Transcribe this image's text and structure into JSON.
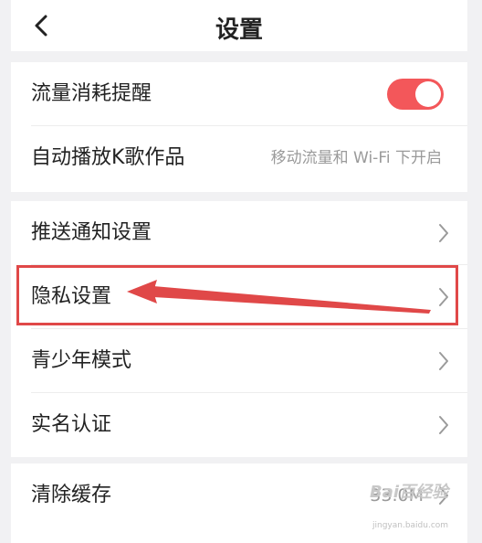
{
  "header": {
    "title": "设置",
    "back_icon": "chevron-left-icon"
  },
  "section1": {
    "rows": [
      {
        "label": "流量消耗提醒",
        "toggle_on": true,
        "toggle_color": "#f3575a"
      },
      {
        "label": "自动播放K歌作品",
        "value": "移动流量和 Wi-Fi 下开启"
      }
    ]
  },
  "section2": {
    "rows": [
      {
        "label": "推送通知设置"
      },
      {
        "label": "隐私设置"
      },
      {
        "label": "青少年模式"
      },
      {
        "label": "实名认证"
      }
    ]
  },
  "section3": {
    "rows": [
      {
        "label": "清除缓存",
        "value": "33.0M"
      }
    ]
  },
  "annotation": {
    "color": "#e04848",
    "highlighted_item": "隐私设置"
  },
  "watermark": {
    "text": "Bai百经验",
    "sub": "jingyan.baidu.com"
  }
}
